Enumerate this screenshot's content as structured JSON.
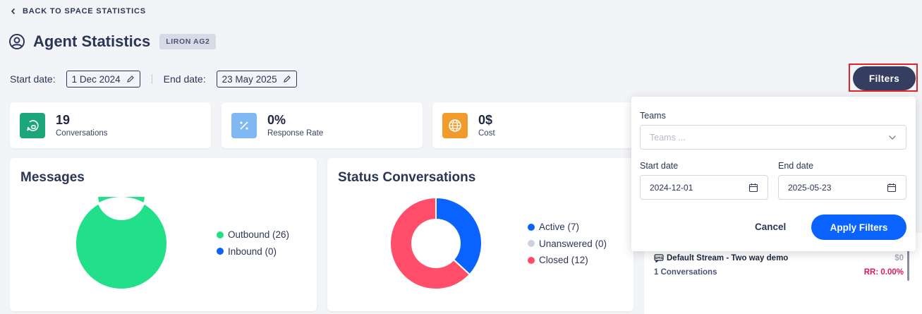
{
  "nav": {
    "back_label": "BACK TO SPACE STATISTICS"
  },
  "header": {
    "title": "Agent Statistics",
    "agent_badge": "LIRON AG2"
  },
  "dates": {
    "start_label": "Start date:",
    "start_value": "1 Dec 2024",
    "end_label": "End date:",
    "end_value": "23 May 2025"
  },
  "filters_button": {
    "label": "Filters"
  },
  "stats": [
    {
      "value": "19",
      "label": "Conversations",
      "icon": "chat-refresh-icon",
      "color": "#1ba77a"
    },
    {
      "value": "0%",
      "label": "Response Rate",
      "icon": "percent-icon",
      "color": "#7fb8f2"
    },
    {
      "value": "0$",
      "label": "Cost",
      "icon": "globe-icon",
      "color": "#f19b2c"
    }
  ],
  "messages_panel": {
    "title": "Messages",
    "chart_data": {
      "type": "pie",
      "donut": true,
      "categories": [
        "Outbound",
        "Inbound"
      ],
      "values": [
        26,
        0
      ],
      "colors": [
        "#22e08a",
        "#0a63ff"
      ],
      "legend_labels": [
        "Outbound (26)",
        "Inbound (0)"
      ],
      "legend_position": "right"
    }
  },
  "status_panel": {
    "title": "Status Conversations",
    "chart_data": {
      "type": "pie",
      "donut": true,
      "categories": [
        "Active",
        "Unanswered",
        "Closed"
      ],
      "values": [
        7,
        0,
        12
      ],
      "colors": [
        "#0a63ff",
        "#cdd2dc",
        "#ff4d6a"
      ],
      "legend_labels": [
        "Active (7)",
        "Unanswered (0)",
        "Closed (12)"
      ],
      "legend_position": "right"
    }
  },
  "stream": {
    "name": "Default Stream - Two way demo",
    "cost": "$0",
    "conversations": "1 Conversations",
    "rr": "RR: 0.00%"
  },
  "filter_popover": {
    "teams_label": "Teams",
    "teams_placeholder": "Teams ...",
    "start_label": "Start date",
    "start_value": "2024-12-01",
    "end_label": "End date",
    "end_value": "2025-05-23",
    "cancel_label": "Cancel",
    "apply_label": "Apply Filters"
  }
}
